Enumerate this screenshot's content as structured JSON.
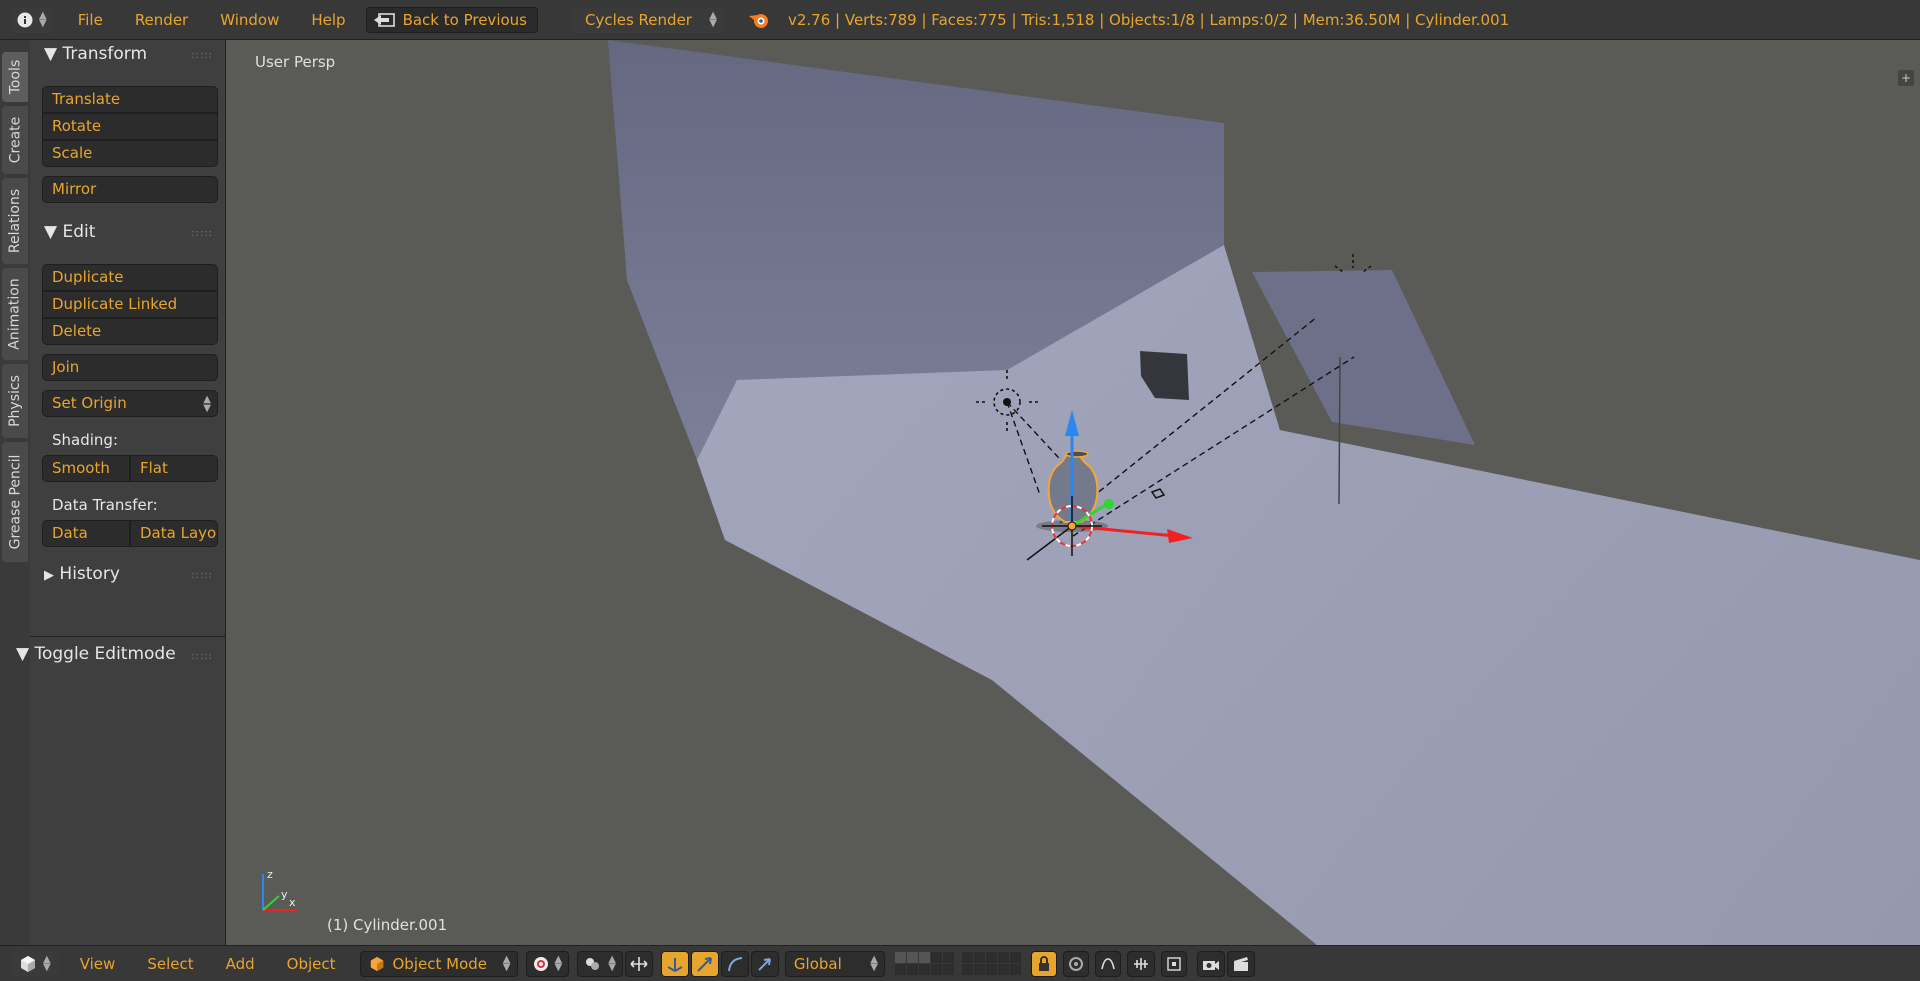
{
  "topbar": {
    "info_icon": "info-icon",
    "menus": [
      "File",
      "Render",
      "Window",
      "Help"
    ],
    "back_button": "Back to Previous",
    "render_engine": "Cycles Render",
    "stats": "v2.76 | Verts:789 | Faces:775 | Tris:1,518 | Objects:1/8 | Lamps:0/2 | Mem:36.50M | Cylinder.001"
  },
  "tabs": [
    "Tools",
    "Create",
    "Relations",
    "Animation",
    "Physics",
    "Grease Pencil"
  ],
  "shelf": {
    "transform": {
      "header": "Transform",
      "translate": "Translate",
      "rotate": "Rotate",
      "scale": "Scale",
      "mirror": "Mirror"
    },
    "edit": {
      "header": "Edit",
      "duplicate": "Duplicate",
      "duplicate_linked": "Duplicate Linked",
      "delete": "Delete",
      "join": "Join",
      "set_origin": "Set Origin",
      "shading_label": "Shading:",
      "smooth": "Smooth",
      "flat": "Flat",
      "data_transfer_label": "Data Transfer:",
      "data": "Data",
      "data_layout": "Data Layo"
    },
    "history": "History",
    "toggle_editmode": "Toggle Editmode"
  },
  "viewport": {
    "view_label": "User Persp",
    "object_label": "(1) Cylinder.001",
    "colors": {
      "floor": "#a3a6bd",
      "wall": "#6d7088",
      "background": "#5a5a56",
      "selection": "#f5a53a"
    }
  },
  "bottombar": {
    "menus": [
      "View",
      "Select",
      "Add",
      "Object"
    ],
    "mode": "Object Mode",
    "orientation": "Global"
  }
}
